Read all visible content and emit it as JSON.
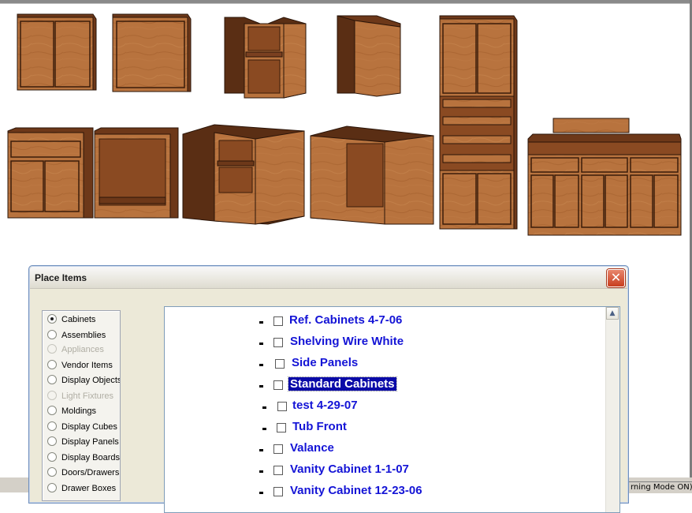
{
  "dialog": {
    "title": "Place Items",
    "close_label": "✕"
  },
  "categories": [
    {
      "label": "Cabinets",
      "selected": true,
      "enabled": true
    },
    {
      "label": "Assemblies",
      "selected": false,
      "enabled": true
    },
    {
      "label": "Appliances",
      "selected": false,
      "enabled": false
    },
    {
      "label": "Vendor Items",
      "selected": false,
      "enabled": true
    },
    {
      "label": "Display Objects",
      "selected": false,
      "enabled": true
    },
    {
      "label": "Light Fixtures",
      "selected": false,
      "enabled": false
    },
    {
      "label": "Moldings",
      "selected": false,
      "enabled": true
    },
    {
      "label": "Display Cubes",
      "selected": false,
      "enabled": true
    },
    {
      "label": "Display Panels",
      "selected": false,
      "enabled": true
    },
    {
      "label": "Display Boards",
      "selected": false,
      "enabled": true
    },
    {
      "label": "Doors/Drawers",
      "selected": false,
      "enabled": true
    },
    {
      "label": "Drawer Boxes",
      "selected": false,
      "enabled": true
    }
  ],
  "library_items": [
    {
      "label": "Ref. Cabinets 4-7-06",
      "checked": false,
      "selected": false
    },
    {
      "label": "Shelving Wire White",
      "checked": false,
      "selected": false
    },
    {
      "label": "Side Panels",
      "checked": false,
      "selected": false
    },
    {
      "label": "Standard Cabinets",
      "checked": false,
      "selected": true
    },
    {
      "label": "test 4-29-07",
      "checked": false,
      "selected": false
    },
    {
      "label": "Tub Front",
      "checked": false,
      "selected": false
    },
    {
      "label": "Valance",
      "checked": false,
      "selected": false
    },
    {
      "label": "Vanity Cabinet 1-1-07",
      "checked": false,
      "selected": false
    },
    {
      "label": "Vanity Cabinet 12-23-06",
      "checked": false,
      "selected": false
    }
  ],
  "scrollbar": {
    "up_arrow": "▲"
  },
  "status": {
    "text": "rning Mode ON)"
  },
  "colors": {
    "wood_light": "#b8733e",
    "wood_mid": "#9a5a2a",
    "wood_dark": "#5a2e14",
    "edge": "#2a1408",
    "link_text": "#1414d6",
    "selection": "#0a0aa8"
  }
}
